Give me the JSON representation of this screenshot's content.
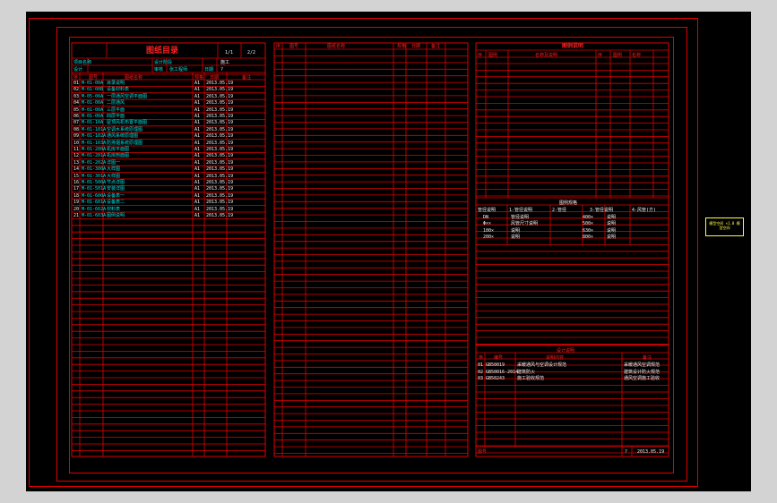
{
  "panel1": {
    "title": "图纸目录",
    "page_current": "1/1",
    "page_total": "2/2",
    "meta": {
      "row1_label": "项目名称",
      "row1_label2": "设计阶段",
      "row1_value2": "施工",
      "row2_label": "设计",
      "row2_label2": "审核",
      "row2_value": "张工程师",
      "row2_label3": "日期",
      "row2_value3": "?"
    },
    "headers": [
      "序",
      "图号",
      "图纸名称",
      "规格",
      "日期",
      "备注"
    ],
    "rows": [
      [
        "01",
        "M-01-00A",
        "目录说明",
        "A1",
        "2013.05.19"
      ],
      [
        "02",
        "M-01-00B",
        "设备材料表",
        "A1",
        "2013.05.19"
      ],
      [
        "03",
        "M-05-00A",
        "一层通风空调平面图",
        "A1",
        "2013.05.19"
      ],
      [
        "04",
        "M-01-00A",
        "二层通风",
        "A1",
        "2013.05.19"
      ],
      [
        "05",
        "M-01-00A",
        "三层平面",
        "A1",
        "2013.05.19"
      ],
      [
        "06",
        "M-01-00A",
        "四层平面",
        "A1",
        "2013.05.19"
      ],
      [
        "07",
        "M-01-10A",
        "屋顶风机布置平面图",
        "A1",
        "2013.05.19"
      ],
      [
        "08",
        "M-01-101A",
        "空调水系统原理图",
        "A1",
        "2013.05.19"
      ],
      [
        "09",
        "M-01-102A",
        "通风系统原理图",
        "A1",
        "2013.05.19"
      ],
      [
        "10",
        "M-01-103A",
        "防排烟系统原理图",
        "A1",
        "2013.05.19"
      ],
      [
        "11",
        "M-01-200A",
        "机房平面图",
        "A1",
        "2013.05.19"
      ],
      [
        "12",
        "M-01-201A",
        "机房剖面图",
        "A1",
        "2013.05.19"
      ],
      [
        "13",
        "M-01-202A",
        "详图一",
        "A1",
        "2013.05.19"
      ],
      [
        "14",
        "M-01-300A",
        "大样图",
        "A1",
        "2013.05.19"
      ],
      [
        "15",
        "M-01-301A",
        "大样图",
        "A1",
        "2013.05.19"
      ],
      [
        "16",
        "M-01-500A",
        "节点详图",
        "A1",
        "2013.05.19"
      ],
      [
        "17",
        "M-01-501A",
        "安装详图",
        "A1",
        "2013.05.19"
      ],
      [
        "18",
        "M-01-600A",
        "设备表一",
        "A1",
        "2013.05.19"
      ],
      [
        "19",
        "M-01-601A",
        "设备表二",
        "A1",
        "2013.05.19"
      ],
      [
        "20",
        "M-01-602A",
        "材料表",
        "A1",
        "2013.05.19"
      ],
      [
        "21",
        "M-01-603A",
        "图例说明",
        "A1",
        "2013.05.19"
      ]
    ]
  },
  "panel2": {
    "headers": [
      "序",
      "图号",
      "图纸名称",
      "规格",
      "日期",
      "备注"
    ]
  },
  "panel3": {
    "title": "图例说明",
    "headers": [
      "序",
      "图例",
      "名称及说明",
      "序",
      "图例",
      "名称"
    ],
    "legend_title": "图例规格",
    "legend_row": [
      "管径说明",
      "1-管径说明",
      "2-管径",
      "3-管径说明",
      "4-风管(方)"
    ],
    "legend_items": [
      [
        "DN",
        "管径说明",
        "400×",
        "说明"
      ],
      [
        "Φ××",
        "风管尺寸说明",
        "500×",
        "说明"
      ],
      [
        "100×",
        "说明",
        "630×",
        "说明"
      ],
      [
        "200×",
        "说明",
        "800×",
        "说明"
      ]
    ],
    "notes_title": "设计说明",
    "notes_headers": [
      "序",
      "编号",
      "说明内容",
      "备注"
    ],
    "notes": [
      [
        "01",
        "GB50019",
        "采暖通风与空调设计规范",
        "采暖通风空调规范"
      ],
      [
        "02",
        "GB50016-2014",
        "建筑防火",
        "建筑设计防火规范"
      ],
      [
        "03",
        "GB50243",
        "施工验收规范",
        "通风空调施工验收"
      ]
    ],
    "footer_label": "图号",
    "footer_date": "2013.05.19",
    "footer_mark": "?"
  },
  "side_label": "模型空间 ×1.0 模型空间"
}
